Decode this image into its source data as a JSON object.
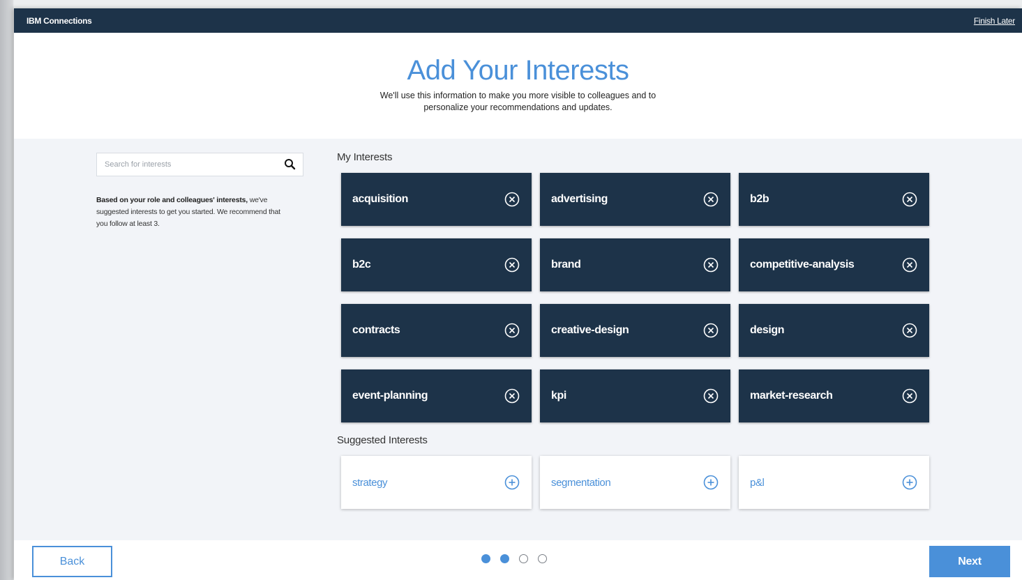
{
  "header": {
    "app_name": "IBM Connections",
    "finish_later": "Finish Later"
  },
  "hero": {
    "title": "Add Your Interests",
    "subtitle": "We'll use this information to make you more visible to colleagues and to personalize your recommendations and updates."
  },
  "sidebar": {
    "search_placeholder": "Search for interests",
    "hint_bold": "Based on your role and colleagues' interests,",
    "hint_rest": " we've suggested interests to get you started. We recommend that you follow at least 3."
  },
  "my_interests": {
    "label": "My Interests",
    "items": [
      {
        "label": "acquisition"
      },
      {
        "label": "advertising"
      },
      {
        "label": "b2b"
      },
      {
        "label": "b2c"
      },
      {
        "label": "brand"
      },
      {
        "label": "competitive-analysis"
      },
      {
        "label": "contracts"
      },
      {
        "label": "creative-design"
      },
      {
        "label": "design"
      },
      {
        "label": "event-planning"
      },
      {
        "label": "kpi"
      },
      {
        "label": "market-research"
      }
    ]
  },
  "suggested_interests": {
    "label": "Suggested Interests",
    "items": [
      {
        "label": "strategy"
      },
      {
        "label": "segmentation"
      },
      {
        "label": "p&l"
      }
    ]
  },
  "footer": {
    "back_label": "Back",
    "next_label": "Next",
    "pagination": {
      "total": 4,
      "filled": 2
    }
  },
  "colors": {
    "navy": "#1d3349",
    "accent": "#4a90d9"
  },
  "icons": {
    "remove": "close-circle-icon",
    "add": "plus-circle-icon",
    "search": "search-icon"
  }
}
